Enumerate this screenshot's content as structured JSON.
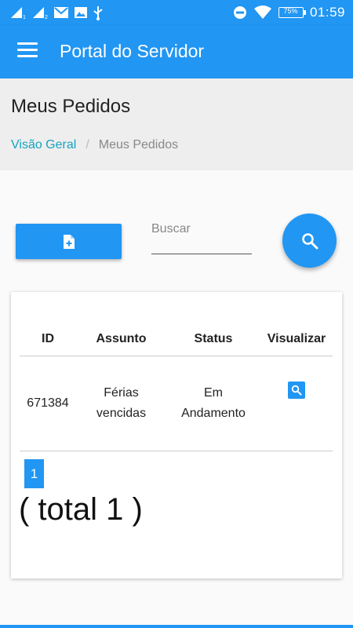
{
  "status_bar": {
    "time": "01:59",
    "battery": "75%",
    "icons": [
      "signal-1-icon",
      "signal-2-icon",
      "gmail-icon",
      "image-icon",
      "usb-icon",
      "do-not-disturb-icon",
      "wifi-icon",
      "battery-icon"
    ]
  },
  "app_bar": {
    "title": "Portal do Servidor",
    "menu_icon": "hamburger-menu-icon"
  },
  "page": {
    "title": "Meus Pedidos"
  },
  "breadcrumb": {
    "items": [
      "Visão Geral",
      "Meus Pedidos"
    ],
    "separator": "/"
  },
  "toolbar": {
    "new_icon": "new-document-icon",
    "search_placeholder": "Buscar",
    "search_value": "",
    "search_icon": "search-icon"
  },
  "table": {
    "headers": [
      "ID",
      "Assunto",
      "Status",
      "Visualizar"
    ],
    "rows": [
      {
        "id": "671384",
        "assunto": [
          "Férias",
          "vencidas"
        ],
        "status": [
          "Em",
          "Andamento"
        ],
        "view_icon": "search-icon"
      }
    ]
  },
  "pagination": {
    "current_page": "1",
    "total_text": "( total 1 )"
  },
  "colors": {
    "primary": "#2196f3",
    "link": "#16a3c0",
    "header_band": "#eeeeee",
    "background": "#fafafa"
  }
}
